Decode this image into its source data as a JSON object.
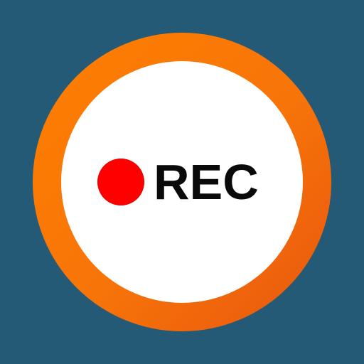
{
  "icon": {
    "label": "REC",
    "dot_icon": "record-dot-icon",
    "colors": {
      "background": "#245a76",
      "ring_start": "#ff7f00",
      "ring_end": "#e8560e",
      "face": "#ffffff",
      "dot": "#ff0000",
      "text": "#0a0a0a"
    }
  }
}
